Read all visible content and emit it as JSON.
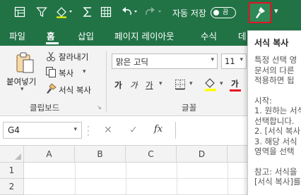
{
  "quick_access": {
    "autosave_label": "자동 저장",
    "autosave_state": "끔",
    "icons": [
      "form-icon",
      "filter-icon",
      "paint-bucket-icon",
      "sum-icon",
      "undo-icon",
      "redo-icon",
      "format-painter-icon",
      "customize-qat-icon"
    ]
  },
  "tabs": [
    "파일",
    "홈",
    "삽입",
    "페이지 레이아웃",
    "수식",
    "데"
  ],
  "active_tab": "홈",
  "ribbon": {
    "clipboard": {
      "paste_label": "붙여넣기",
      "cut_label": "잘라내기",
      "copy_label": "복사",
      "format_painter_label": "서식 복사",
      "group_label": "클립보드"
    },
    "font": {
      "font_name": "맑은 고딕",
      "font_size": "11",
      "bold": "가",
      "italic": "가",
      "underline": "가",
      "font_color_glyph": "가",
      "group_label": "글꼴"
    },
    "colors": {
      "accent": "#217346",
      "highlight_border": "#e81123",
      "font_color": "#e81123",
      "fill_color": "#ffff00"
    }
  },
  "formula_bar": {
    "name_box": "G4",
    "fx_label": "fx",
    "formula": ""
  },
  "grid": {
    "columns": [
      "A",
      "B",
      "C",
      "D"
    ],
    "rows": [
      "1",
      "2"
    ]
  },
  "tooltip": {
    "title": "서식 복사",
    "lines": [
      "특정 선택 영",
      "문서의 다른",
      "적용하면 됩"
    ],
    "start_heading": "시작:",
    "steps": [
      "1. 원하는 서식",
      "선택합니다.",
      "2. [서식 복사",
      "3. 해당 서식",
      "영역을 선택"
    ],
    "note_lines": [
      "참고: 서식을",
      "[서식 복사]를"
    ]
  }
}
